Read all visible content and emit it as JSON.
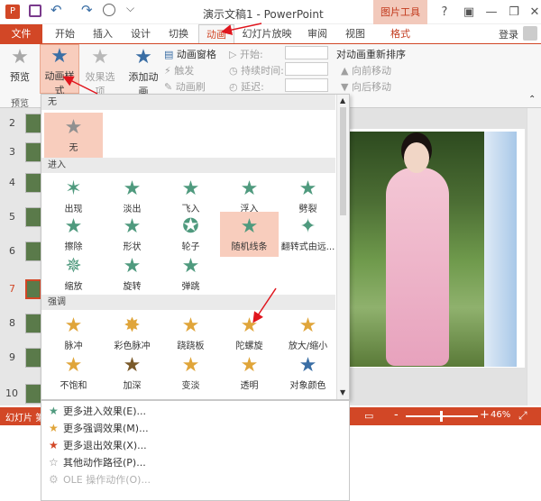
{
  "window": {
    "title": "演示文稿1 - PowerPoint",
    "context_tab_group": "图片工具",
    "help": "?",
    "login": "登录"
  },
  "tabs": [
    {
      "label": "文件"
    },
    {
      "label": "开始"
    },
    {
      "label": "插入"
    },
    {
      "label": "设计"
    },
    {
      "label": "切换"
    },
    {
      "label": "动画"
    },
    {
      "label": "幻灯片放映"
    },
    {
      "label": "审阅"
    },
    {
      "label": "视图"
    },
    {
      "label": "格式"
    }
  ],
  "ribbon": {
    "preview_label": "预览",
    "preview_group": "预览",
    "animation_styles": "动画样式",
    "effect_options": "效果选项",
    "add_animation": "添加动画",
    "animation_pane": "动画窗格",
    "trigger": "触发",
    "animation_painter": "动画刷",
    "start_label": "开始:",
    "duration_label": "持续时间:",
    "delay_label": "延迟:",
    "reorder_title": "对动画重新排序",
    "move_earlier": "向前移动",
    "move_later": "向后移动"
  },
  "slides": {
    "numbers": [
      "2",
      "3",
      "4",
      "5",
      "6",
      "7",
      "8",
      "9",
      "10"
    ],
    "selected": "7"
  },
  "gallery": {
    "sections": {
      "none": "无",
      "entrance": "进入",
      "emphasis": "强调"
    },
    "none_items": [
      {
        "label": "无",
        "icon": "star-gray-icon"
      }
    ],
    "entrance_items": [
      {
        "label": "出现"
      },
      {
        "label": "淡出"
      },
      {
        "label": "飞入"
      },
      {
        "label": "浮入"
      },
      {
        "label": "劈裂"
      },
      {
        "label": "擦除"
      },
      {
        "label": "形状"
      },
      {
        "label": "轮子"
      },
      {
        "label": "随机线条"
      },
      {
        "label": "翻转式由远..."
      },
      {
        "label": "缩放"
      },
      {
        "label": "旋转"
      },
      {
        "label": "弹跳"
      }
    ],
    "emphasis_items": [
      {
        "label": "脉冲"
      },
      {
        "label": "彩色脉冲"
      },
      {
        "label": "跷跷板"
      },
      {
        "label": "陀螺旋"
      },
      {
        "label": "放大/缩小"
      },
      {
        "label": "不饱和"
      },
      {
        "label": "加深"
      },
      {
        "label": "变淡"
      },
      {
        "label": "透明"
      },
      {
        "label": "对象颜色"
      }
    ]
  },
  "more_effects": [
    {
      "label": "更多进入效果(E)...",
      "color": "#4f9a7e",
      "enabled": true
    },
    {
      "label": "更多强调效果(M)...",
      "color": "#e0a53a",
      "enabled": true
    },
    {
      "label": "更多退出效果(X)...",
      "color": "#d24726",
      "enabled": true
    },
    {
      "label": "其他动作路径(P)...",
      "color": "#888888",
      "enabled": true
    },
    {
      "label": "OLE 操作动作(O)...",
      "color": "#c0c0c0",
      "enabled": false
    }
  ],
  "status": {
    "slide_prefix": "幻灯片 第",
    "zoom": "46%",
    "minus": "-",
    "plus": "+"
  },
  "colors": {
    "accent": "#d24726",
    "selected": "#f8cdbd",
    "entrance": "#4f9a7e",
    "emphasis": "#e0a53a"
  }
}
